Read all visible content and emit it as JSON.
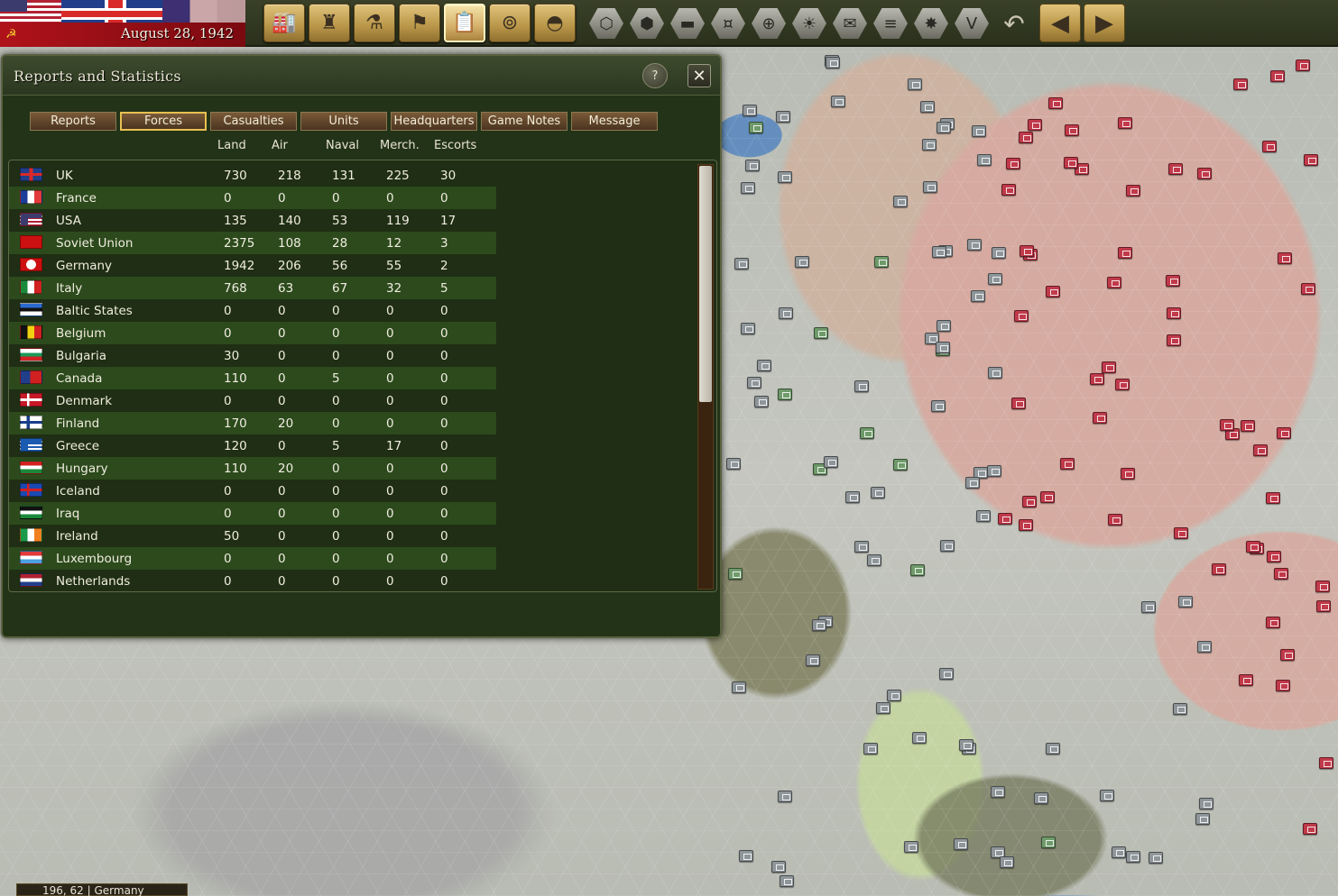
{
  "topbar": {
    "date": "August 28, 1942",
    "toolbar_icons": [
      "factory-icon",
      "soldier-icon",
      "microscope-icon",
      "flag-icon",
      "report-icon",
      "binoculars-icon",
      "helmet-icon"
    ],
    "hex_icons": [
      "hex-icon",
      "hexes-icon",
      "tank-icon",
      "coins-icon",
      "target-icon",
      "sun-icon",
      "mail-icon",
      "rail-icon",
      "explosion-icon",
      "victory-icon",
      "undo-icon"
    ]
  },
  "dialog": {
    "title": "Reports and Statistics",
    "help_label": "?",
    "close_label": "✕",
    "tabs": [
      "Reports",
      "Forces",
      "Casualties",
      "Units",
      "Headquarters",
      "Game Notes",
      "Message"
    ],
    "active_tab": "Forces",
    "columns": [
      "Land",
      "Air",
      "Naval",
      "Merch.",
      "Escorts"
    ],
    "rows": [
      {
        "country": "UK",
        "land": "730",
        "air": "218",
        "naval": "131",
        "merch": "225",
        "escorts": "30"
      },
      {
        "country": "France",
        "land": "0",
        "air": "0",
        "naval": "0",
        "merch": "0",
        "escorts": "0"
      },
      {
        "country": "USA",
        "land": "135",
        "air": "140",
        "naval": "53",
        "merch": "119",
        "escorts": "17"
      },
      {
        "country": "Soviet Union",
        "land": "2375",
        "air": "108",
        "naval": "28",
        "merch": "12",
        "escorts": "3"
      },
      {
        "country": "Germany",
        "land": "1942",
        "air": "206",
        "naval": "56",
        "merch": "55",
        "escorts": "2"
      },
      {
        "country": "Italy",
        "land": "768",
        "air": "63",
        "naval": "67",
        "merch": "32",
        "escorts": "5"
      },
      {
        "country": "Baltic States",
        "land": "0",
        "air": "0",
        "naval": "0",
        "merch": "0",
        "escorts": "0"
      },
      {
        "country": "Belgium",
        "land": "0",
        "air": "0",
        "naval": "0",
        "merch": "0",
        "escorts": "0"
      },
      {
        "country": "Bulgaria",
        "land": "30",
        "air": "0",
        "naval": "0",
        "merch": "0",
        "escorts": "0"
      },
      {
        "country": "Canada",
        "land": "110",
        "air": "0",
        "naval": "5",
        "merch": "0",
        "escorts": "0"
      },
      {
        "country": "Denmark",
        "land": "0",
        "air": "0",
        "naval": "0",
        "merch": "0",
        "escorts": "0"
      },
      {
        "country": "Finland",
        "land": "170",
        "air": "20",
        "naval": "0",
        "merch": "0",
        "escorts": "0"
      },
      {
        "country": "Greece",
        "land": "120",
        "air": "0",
        "naval": "5",
        "merch": "17",
        "escorts": "0"
      },
      {
        "country": "Hungary",
        "land": "110",
        "air": "20",
        "naval": "0",
        "merch": "0",
        "escorts": "0"
      },
      {
        "country": "Iceland",
        "land": "0",
        "air": "0",
        "naval": "0",
        "merch": "0",
        "escorts": "0"
      },
      {
        "country": "Iraq",
        "land": "0",
        "air": "0",
        "naval": "0",
        "merch": "0",
        "escorts": "0"
      },
      {
        "country": "Ireland",
        "land": "50",
        "air": "0",
        "naval": "0",
        "merch": "0",
        "escorts": "0"
      },
      {
        "country": "Luxembourg",
        "land": "0",
        "air": "0",
        "naval": "0",
        "merch": "0",
        "escorts": "0"
      },
      {
        "country": "Netherlands",
        "land": "0",
        "air": "0",
        "naval": "0",
        "merch": "0",
        "escorts": "0"
      }
    ]
  },
  "status": {
    "coords": "196, 62",
    "region": "Germany"
  }
}
